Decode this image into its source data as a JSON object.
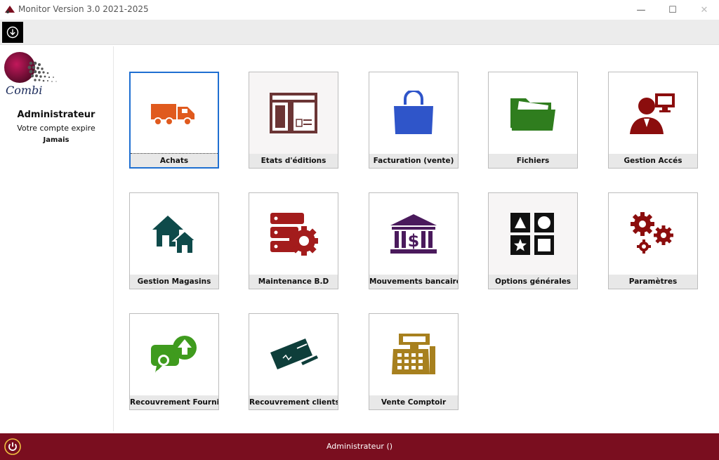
{
  "window": {
    "title": "Monitor  Version 3.0 2021-2025",
    "minimize": "—",
    "maximize": "☐",
    "close": "✕"
  },
  "sidebar": {
    "logo_text": "Combi",
    "user_name": "Administrateur",
    "expire_label": "Votre compte expire",
    "expire_value": "Jamais"
  },
  "tiles": [
    {
      "label": "Achats",
      "icon": "truck-icon",
      "color": "#e05a1e"
    },
    {
      "label": "Etats d'éditions",
      "icon": "layout-icon",
      "color": "#6b3535"
    },
    {
      "label": "Facturation (vente)",
      "icon": "shopping-bag-icon",
      "color": "#2f55c9"
    },
    {
      "label": "Fichiers",
      "icon": "folder-icon",
      "color": "#2f7d1e"
    },
    {
      "label": "Gestion Accés",
      "icon": "user-computer-icon",
      "color": "#8b0d0d"
    },
    {
      "label": "Gestion Magasins",
      "icon": "houses-icon",
      "color": "#0e4a4a"
    },
    {
      "label": "Maintenance B.D",
      "icon": "database-gear-icon",
      "color": "#a31c1c"
    },
    {
      "label": "Mouvements bancaires",
      "icon": "bank-icon",
      "color": "#4a1a5c"
    },
    {
      "label": "Options générales",
      "icon": "shapes-icon",
      "color": "#111111"
    },
    {
      "label": "Paramètres",
      "icon": "gears-icon",
      "color": "#8b0d0d"
    },
    {
      "label": "Recouvrement Fourniss",
      "icon": "user-upload-icon",
      "color": "#3f9b1e"
    },
    {
      "label": "Recouvrement clients",
      "icon": "check-payment-icon",
      "color": "#0e3e3a"
    },
    {
      "label": "Vente Comptoir",
      "icon": "cash-register-icon",
      "color": "#a7801e"
    }
  ],
  "statusbar": {
    "text": "Administrateur ()",
    "accent": "#7a0e1f"
  }
}
